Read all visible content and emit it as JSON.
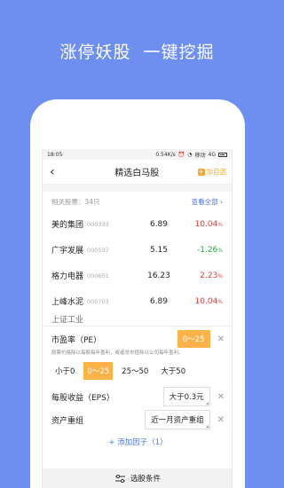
{
  "headline": {
    "part1": "涨停妖股",
    "part2": "一键挖掘"
  },
  "statusbar": {
    "time": "18:05",
    "speed": "0.54K/s",
    "carrier": "移动",
    "network": "4G"
  },
  "nav": {
    "back": "‹",
    "title": "精选白马股",
    "add_fav": "加自选"
  },
  "related": {
    "label": "相关股票：34只",
    "view_all": "查看全部 ›"
  },
  "stocks": [
    {
      "name": "美的集团",
      "code": "000333",
      "price": "6.89",
      "change": "10.04",
      "pct": "%"
    },
    {
      "name": "广宇发展",
      "code": "000537",
      "price": "5.15",
      "change": "-1.26",
      "pct": "%"
    },
    {
      "name": "格力电器",
      "code": "000651",
      "price": "16.23",
      "change": "2.23",
      "pct": "%"
    },
    {
      "name": "上峰水泥",
      "code": "000703",
      "price": "6.89",
      "change": "10.04",
      "pct": "%"
    }
  ],
  "partial_row": "上证工业",
  "filters": {
    "pe": {
      "label": "市盈率（PE）",
      "value": "0〜25",
      "desc": "股票价格除以每股每年盈利，或者总市值除以公司每年盈利。",
      "options": [
        "小于0",
        "0〜25",
        "25〜50",
        "大于50"
      ]
    },
    "eps": {
      "label": "每股收益（EPS）",
      "value": "大于0.3元"
    },
    "restructure": {
      "label": "资产重组",
      "value": "近一月资产重组"
    }
  },
  "add_factor": "+ 添加因子（1）",
  "footer": {
    "label": "选股条件"
  },
  "colors": {
    "background": "#6e8ef0",
    "accent": "#fbb349",
    "up": "#e23b3b",
    "down": "#2aa54a",
    "link": "#4a76e0"
  }
}
